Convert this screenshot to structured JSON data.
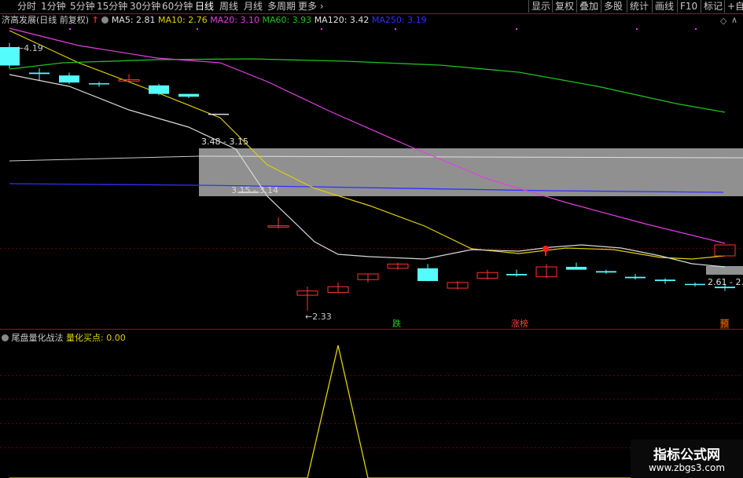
{
  "toolbar": {
    "tabs": [
      "分时",
      "1分钟",
      "5分钟",
      "15分钟",
      "30分钟",
      "60分钟",
      "日线",
      "周线",
      "月线",
      "多周期",
      "更多"
    ],
    "active_tab": "日线",
    "right_buttons": [
      "显示",
      "复权",
      "叠加",
      "多股",
      "统计",
      "画线",
      "F10",
      "标记",
      "+自"
    ]
  },
  "main_legend": {
    "stock_title": "济高发展(日线 前复权)",
    "ma": [
      {
        "label": "MA5: 2.81",
        "color": "#e0e0e0"
      },
      {
        "label": "MA10: 2.76",
        "color": "#e0d000"
      },
      {
        "label": "MA20: 3.10",
        "color": "#e040e0"
      },
      {
        "label": "MA60: 3.93",
        "color": "#20c020"
      },
      {
        "label": "MA120: 3.42",
        "color": "#e0e0e0"
      },
      {
        "label": "MA250: 3.19",
        "color": "#3030ff"
      }
    ]
  },
  "chart_labels": {
    "high_price": "4.19",
    "low_price": "2.33",
    "zone_upper": "3.48 - 3.15",
    "zone_lower": "3.15 - 3.14",
    "zone_right": "2.61 - 2.6"
  },
  "badges": [
    {
      "text": "跌",
      "color": "#20d020"
    },
    {
      "text": "涨榜",
      "color": "#ff4040"
    },
    {
      "text": "预",
      "color": "#ff6000"
    }
  ],
  "sub_legend": {
    "title": "尾盘量化战法",
    "indicator": "量化买点: 0.00"
  },
  "watermark": {
    "title": "指标公式网",
    "url": "www.zbgs3.com"
  },
  "chart_data": {
    "type": "candlestick",
    "candles": [
      {
        "o": 4.06,
        "c": 4.19,
        "h": 4.22,
        "l": 4.04,
        "dir": "down"
      },
      {
        "o": 4.01,
        "c": 4.0,
        "h": 4.04,
        "l": 3.95,
        "dir": "down"
      },
      {
        "o": 3.99,
        "c": 3.94,
        "h": 4.01,
        "l": 3.93,
        "dir": "down"
      },
      {
        "o": 3.935,
        "c": 3.93,
        "h": 3.945,
        "l": 3.91,
        "dir": "down"
      },
      {
        "o": 3.96,
        "c": 3.95,
        "h": 4.0,
        "l": 3.94,
        "dir": "up"
      },
      {
        "o": 3.92,
        "c": 3.86,
        "h": 3.93,
        "l": 3.85,
        "dir": "down"
      },
      {
        "o": 3.86,
        "c": 3.84,
        "h": 3.86,
        "l": 3.83,
        "dir": "down"
      },
      {
        "o": 3.72,
        "c": 3.72,
        "h": 3.72,
        "l": 3.72,
        "dir": "flat"
      },
      {
        "o": 3.17,
        "c": 3.17,
        "h": 3.17,
        "l": 3.17,
        "dir": "flat"
      },
      {
        "o": 2.92,
        "c": 2.93,
        "h": 2.99,
        "l": 2.91,
        "dir": "up"
      },
      {
        "o": 2.47,
        "c": 2.44,
        "h": 2.5,
        "l": 2.33,
        "dir": "up"
      },
      {
        "o": 2.46,
        "c": 2.5,
        "h": 2.53,
        "l": 2.46,
        "dir": "up"
      },
      {
        "o": 2.55,
        "c": 2.59,
        "h": 2.59,
        "l": 2.53,
        "dir": "up"
      },
      {
        "o": 2.66,
        "c": 2.63,
        "h": 2.67,
        "l": 2.62,
        "dir": "up"
      },
      {
        "o": 2.63,
        "c": 2.54,
        "h": 2.66,
        "l": 2.54,
        "dir": "down"
      },
      {
        "o": 2.49,
        "c": 2.53,
        "h": 2.54,
        "l": 2.48,
        "dir": "up"
      },
      {
        "o": 2.6,
        "c": 2.56,
        "h": 2.62,
        "l": 2.55,
        "dir": "up"
      },
      {
        "o": 2.59,
        "c": 2.58,
        "h": 2.62,
        "l": 2.57,
        "dir": "down"
      },
      {
        "o": 2.57,
        "c": 2.64,
        "h": 2.66,
        "l": 2.56,
        "dir": "up"
      },
      {
        "o": 2.64,
        "c": 2.62,
        "h": 2.67,
        "l": 2.62,
        "dir": "down"
      },
      {
        "o": 2.61,
        "c": 2.6,
        "h": 2.62,
        "l": 2.59,
        "dir": "down"
      },
      {
        "o": 2.57,
        "c": 2.56,
        "h": 2.59,
        "l": 2.55,
        "dir": "down"
      },
      {
        "o": 2.55,
        "c": 2.54,
        "h": 2.56,
        "l": 2.52,
        "dir": "down"
      },
      {
        "o": 2.52,
        "c": 2.515,
        "h": 2.53,
        "l": 2.5,
        "dir": "down"
      },
      {
        "o": 2.5,
        "c": 2.49,
        "h": 2.52,
        "l": 2.47,
        "dir": "down"
      },
      {
        "o": 2.56,
        "c": 2.61,
        "h": 2.62,
        "l": 2.54,
        "dir": "up"
      }
    ],
    "indicator_signal": [
      0,
      0,
      0,
      0,
      0,
      0,
      0,
      0,
      0,
      0,
      0,
      1,
      0,
      0,
      0,
      0,
      0,
      0,
      0,
      0,
      0,
      0,
      0,
      0,
      0,
      0
    ]
  }
}
